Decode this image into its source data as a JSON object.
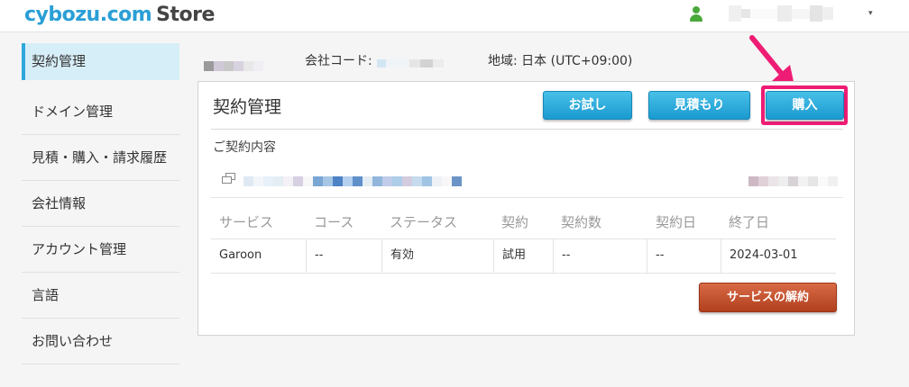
{
  "header": {
    "logo_brand": "cybozu.com",
    "logo_store": "Store",
    "user_icon": "user-icon",
    "dropdown_caret": "▾"
  },
  "sidebar": {
    "items": [
      {
        "label": "契約管理",
        "active": true
      },
      {
        "label": "ドメイン管理",
        "active": false
      },
      {
        "label": "見積・購入・請求履歴",
        "active": false
      },
      {
        "label": "会社情報",
        "active": false
      },
      {
        "label": "アカウント管理",
        "active": false
      },
      {
        "label": "言語",
        "active": false
      },
      {
        "label": "お問い合わせ",
        "active": false
      }
    ]
  },
  "info": {
    "company_code_label": "会社コード:",
    "region_label": "地域: 日本 (UTC+09:00)"
  },
  "panel": {
    "title": "契約管理",
    "buttons": {
      "trial": "お試し",
      "quote": "見積もり",
      "buy": "購入"
    },
    "contract_section_label": "ご契約内容",
    "table": {
      "headers": [
        "サービス",
        "コース",
        "ステータス",
        "契約",
        "契約数",
        "契約日",
        "終了日"
      ],
      "rows": [
        [
          "Garoon",
          "--",
          "有効",
          "試用",
          "--",
          "--",
          "2024-03-01"
        ]
      ]
    },
    "cancel_button": "サービスの解約"
  },
  "colors": {
    "accent_blue": "#2ea8dc",
    "highlight_pink": "#ee1c74",
    "cancel_red": "#b0401e",
    "user_green": "#49a83a"
  }
}
